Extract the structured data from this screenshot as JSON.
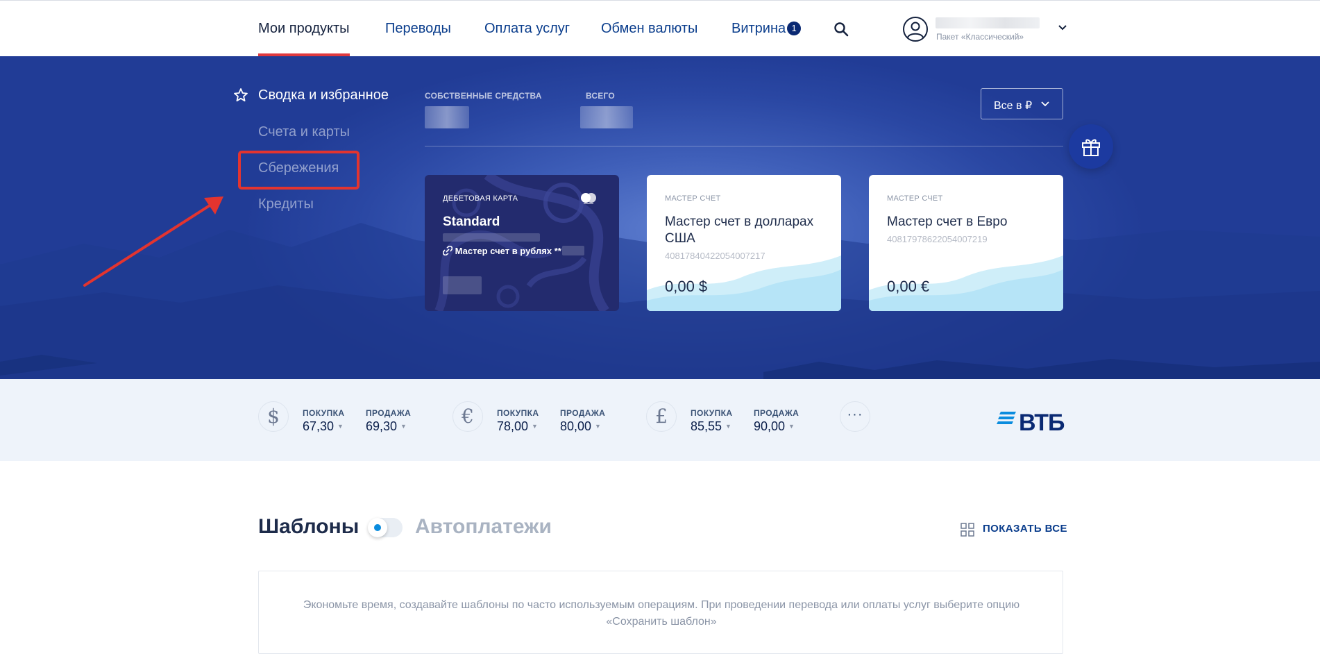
{
  "nav": {
    "items": [
      {
        "label": "Мои продукты"
      },
      {
        "label": "Переводы"
      },
      {
        "label": "Оплата услуг"
      },
      {
        "label": "Обмен валюты"
      },
      {
        "label": "Витрина"
      }
    ],
    "showcase_badge": "1",
    "user_package": "Пакет «Классический»"
  },
  "sidebar": {
    "main": "Сводка и избранное",
    "items": [
      {
        "label": "Счета и карты"
      },
      {
        "label": "Сбережения"
      },
      {
        "label": "Кредиты"
      }
    ]
  },
  "balance": {
    "own_label": "СОБСТВЕННЫЕ СРЕДСТВА",
    "total_label": "ВСЕГО",
    "currency_select": "Все в ₽"
  },
  "cards": [
    {
      "type": "ДЕБЕТОВАЯ КАРТА",
      "title": "Standard",
      "linked": "Мастер счет в рублях **"
    },
    {
      "type": "МАСТЕР СЧЕТ",
      "title": "Мастер счет в долларах США",
      "number": "40817840422054007217",
      "amount": "0,00 $"
    },
    {
      "type": "МАСТЕР СЧЕТ",
      "title": "Мастер счет в Евро",
      "number": "40817978622054007219",
      "amount": "0,00 €"
    }
  ],
  "rates": {
    "buy_label": "ПОКУПКА",
    "sell_label": "ПРОДАЖА",
    "items": [
      {
        "symbol": "$",
        "buy": "67,30",
        "sell": "69,30"
      },
      {
        "symbol": "€",
        "buy": "78,00",
        "sell": "80,00"
      },
      {
        "symbol": "£",
        "buy": "85,55",
        "sell": "90,00"
      }
    ],
    "bank_name": "ВТБ"
  },
  "templates": {
    "title": "Шаблоны",
    "auto_title": "Автоплатежи",
    "show_all": "ПОКАЗАТЬ ВСЕ",
    "hint": "Экономьте время, создавайте шаблоны по часто используемым операциям. При проведении перевода или оплаты услуг выберите опцию «Сохранить шаблон»"
  },
  "colors": {
    "accent_red": "#e0393e",
    "brand_blue": "#0a2973",
    "hero_blue": "#2a47a3"
  }
}
